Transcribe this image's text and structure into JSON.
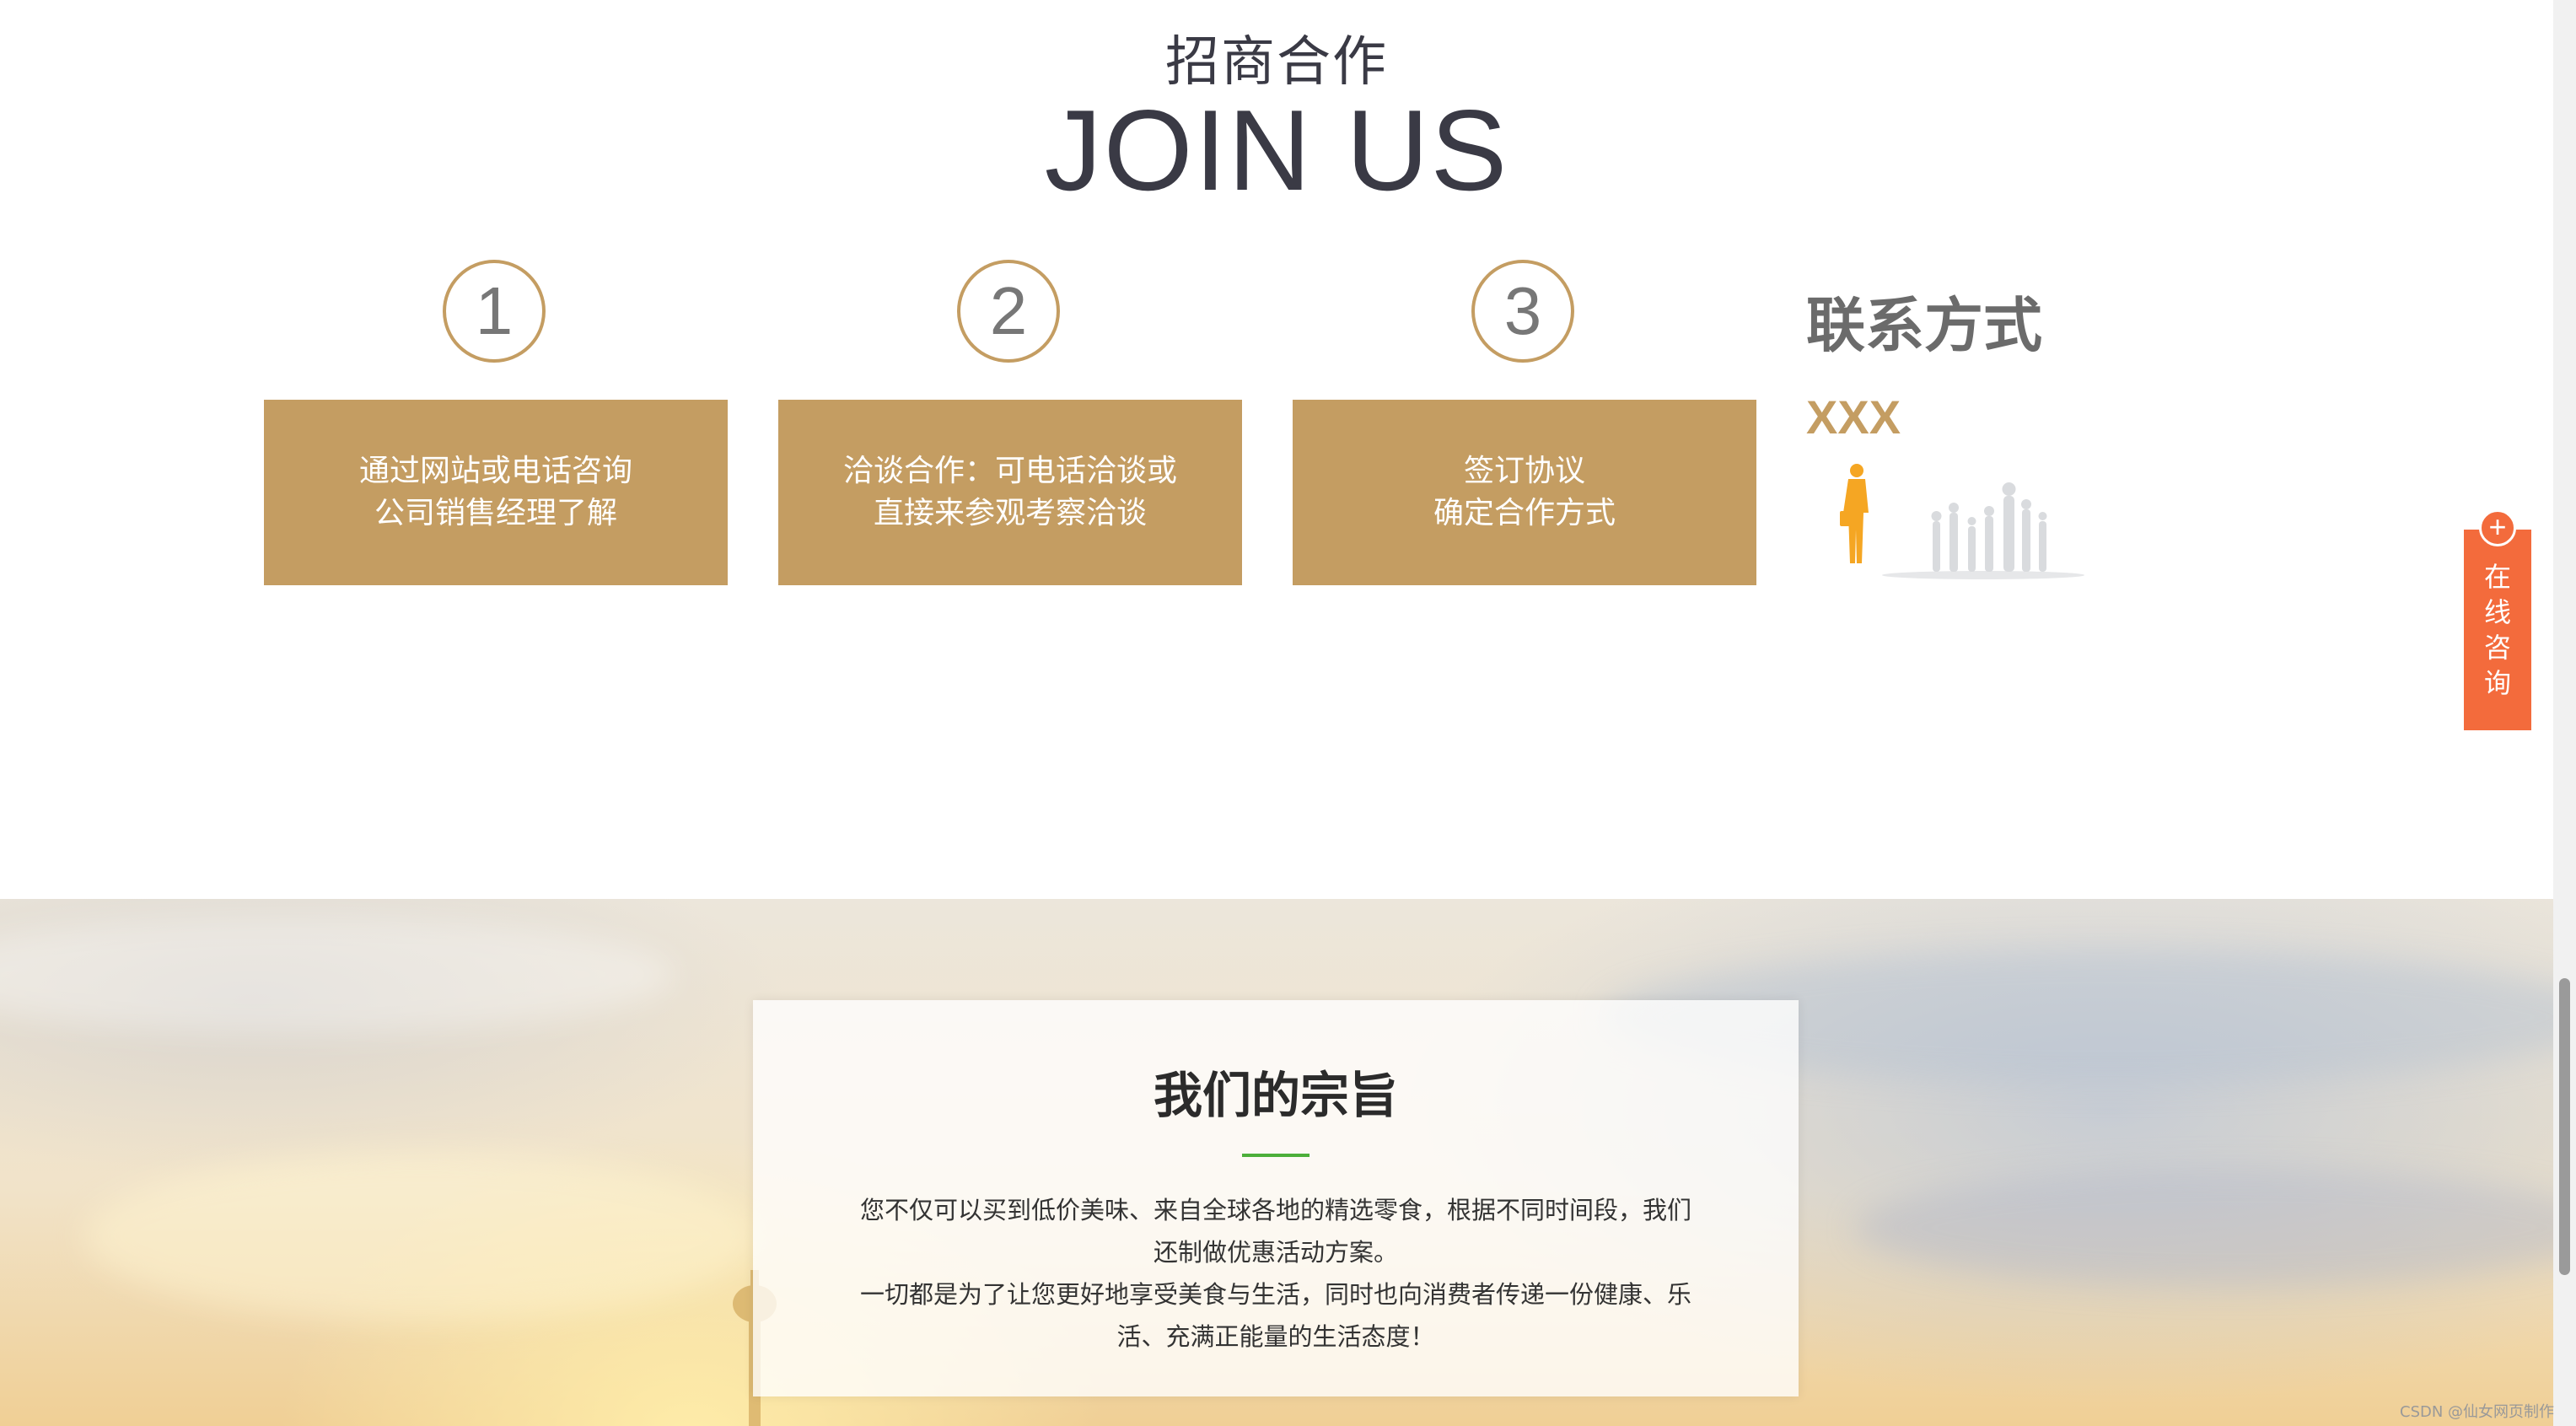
{
  "join": {
    "title_cn": "招商合作",
    "title_en": "JOIN US",
    "steps": [
      {
        "number": "1",
        "line1": "通过网站或电话咨询",
        "line2": "公司销售经理了解"
      },
      {
        "number": "2",
        "line1": "洽谈合作：可电话洽谈或",
        "line2": "直接来参观考察洽谈"
      },
      {
        "number": "3",
        "line1": "签订协议",
        "line2": "确定合作方式"
      }
    ],
    "contact": {
      "title": "联系方式",
      "value": "XXX"
    }
  },
  "consult": {
    "label_chars": [
      "在",
      "线",
      "咨",
      "询"
    ],
    "icon": "plus-circle-icon"
  },
  "purpose": {
    "title": "我们的宗旨",
    "paragraph1": "您不仅可以买到低价美味、来自全球各地的精选零食，根据不同时间段，我们还制做优惠活动方案。",
    "paragraph2": "一切都是为了让您更好地享受美食与生活，同时也向消费者传递一份健康、乐活、充满正能量的生活态度！"
  },
  "watermark": "CSDN @仙女网页制作",
  "colors": {
    "accent": "#c49d62",
    "consult": "#f36b3c",
    "divider": "#4caf3a"
  }
}
